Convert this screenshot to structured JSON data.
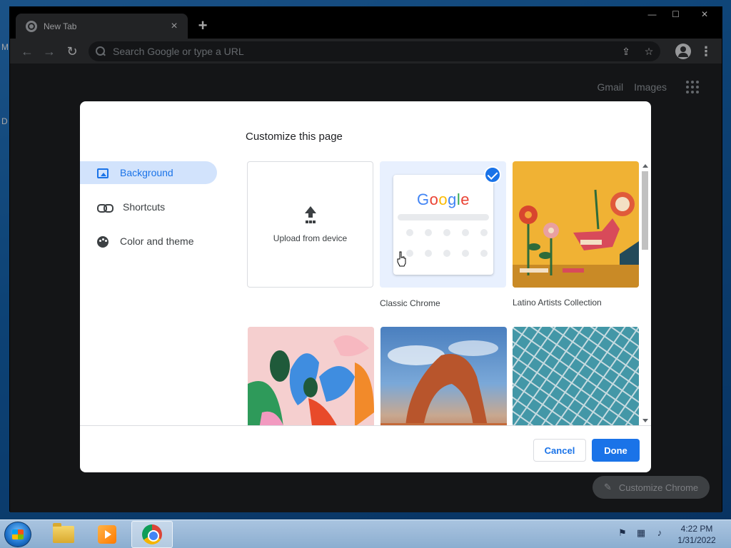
{
  "desktop": {
    "letters": [
      "M",
      "D"
    ]
  },
  "browser": {
    "tab": {
      "title": "New Tab",
      "close": "×"
    },
    "new_tab": "+",
    "window_controls": {
      "minimize": "—",
      "maximize": "☐",
      "close": "✕"
    },
    "omnibox": {
      "placeholder": "Search Google or type a URL"
    },
    "top_links": {
      "gmail": "Gmail",
      "images": "Images"
    },
    "customize_chrome": "Customize Chrome"
  },
  "dialog": {
    "title": "Customize this page",
    "nav": [
      {
        "label": "Background",
        "active": true,
        "icon": "image-icon"
      },
      {
        "label": "Shortcuts",
        "active": false,
        "icon": "link-icon"
      },
      {
        "label": "Color and theme",
        "active": false,
        "icon": "palette-icon"
      }
    ],
    "tiles": {
      "upload": "Upload from device",
      "classic": "Classic Chrome",
      "latino": "Latino Artists Collection",
      "classic_logo": [
        "G",
        "o",
        "o",
        "g",
        "l",
        "e"
      ],
      "classic_logo_colors": [
        "#4285f4",
        "#ea4335",
        "#fbbc05",
        "#4285f4",
        "#34a853",
        "#ea4335"
      ],
      "selected": "Classic Chrome"
    },
    "buttons": {
      "cancel": "Cancel",
      "done": "Done"
    }
  },
  "taskbar": {
    "clock_time": "4:22 PM",
    "clock_date": "1/31/2022"
  },
  "colors": {
    "accent": "#1a73e8",
    "active_nav_bg": "#d2e3fc",
    "browser_dark": "#202124"
  }
}
